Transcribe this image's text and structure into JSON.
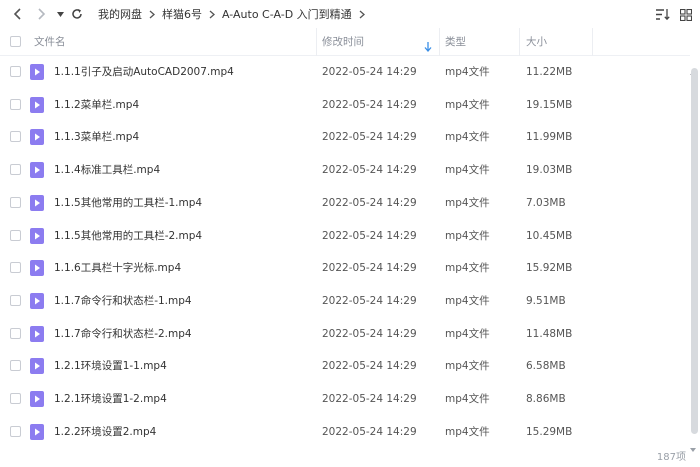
{
  "toolbar": {
    "back_icon": "chevron-left-icon",
    "forward_icon": "chevron-right-icon",
    "dropdown_icon": "caret-down-icon",
    "refresh_icon": "refresh-icon",
    "sort_icon": "sort-list-icon",
    "grid_icon": "grid-view-icon"
  },
  "breadcrumb": [
    "我的网盘",
    "样猫6号",
    "A-Auto C-A-D 入门到精通"
  ],
  "header": {
    "name": "文件名",
    "modified": "修改时间",
    "type": "类型",
    "size": "大小"
  },
  "files": [
    {
      "name": "1.1.1引子及启动AutoCAD2007.mp4",
      "modified": "2022-05-24 14:29",
      "type": "mp4文件",
      "size": "11.22MB"
    },
    {
      "name": "1.1.2菜单栏.mp4",
      "modified": "2022-05-24 14:29",
      "type": "mp4文件",
      "size": "19.15MB"
    },
    {
      "name": "1.1.3菜单栏.mp4",
      "modified": "2022-05-24 14:29",
      "type": "mp4文件",
      "size": "11.99MB"
    },
    {
      "name": "1.1.4标准工具栏.mp4",
      "modified": "2022-05-24 14:29",
      "type": "mp4文件",
      "size": "19.03MB"
    },
    {
      "name": "1.1.5其他常用的工具栏-1.mp4",
      "modified": "2022-05-24 14:29",
      "type": "mp4文件",
      "size": "7.03MB"
    },
    {
      "name": "1.1.5其他常用的工具栏-2.mp4",
      "modified": "2022-05-24 14:29",
      "type": "mp4文件",
      "size": "10.45MB"
    },
    {
      "name": "1.1.6工具栏十字光标.mp4",
      "modified": "2022-05-24 14:29",
      "type": "mp4文件",
      "size": "15.92MB"
    },
    {
      "name": "1.1.7命令行和状态栏-1.mp4",
      "modified": "2022-05-24 14:29",
      "type": "mp4文件",
      "size": "9.51MB"
    },
    {
      "name": "1.1.7命令行和状态栏-2.mp4",
      "modified": "2022-05-24 14:29",
      "type": "mp4文件",
      "size": "11.48MB"
    },
    {
      "name": "1.2.1环境设置1-1.mp4",
      "modified": "2022-05-24 14:29",
      "type": "mp4文件",
      "size": "6.58MB"
    },
    {
      "name": "1.2.1环境设置1-2.mp4",
      "modified": "2022-05-24 14:29",
      "type": "mp4文件",
      "size": "8.86MB"
    },
    {
      "name": "1.2.2环境设置2.mp4",
      "modified": "2022-05-24 14:29",
      "type": "mp4文件",
      "size": "15.29MB"
    }
  ],
  "footer": {
    "count": "187项"
  },
  "colors": {
    "video_icon": "#8c7cf0",
    "sort_arrow": "#3a8ee6"
  }
}
